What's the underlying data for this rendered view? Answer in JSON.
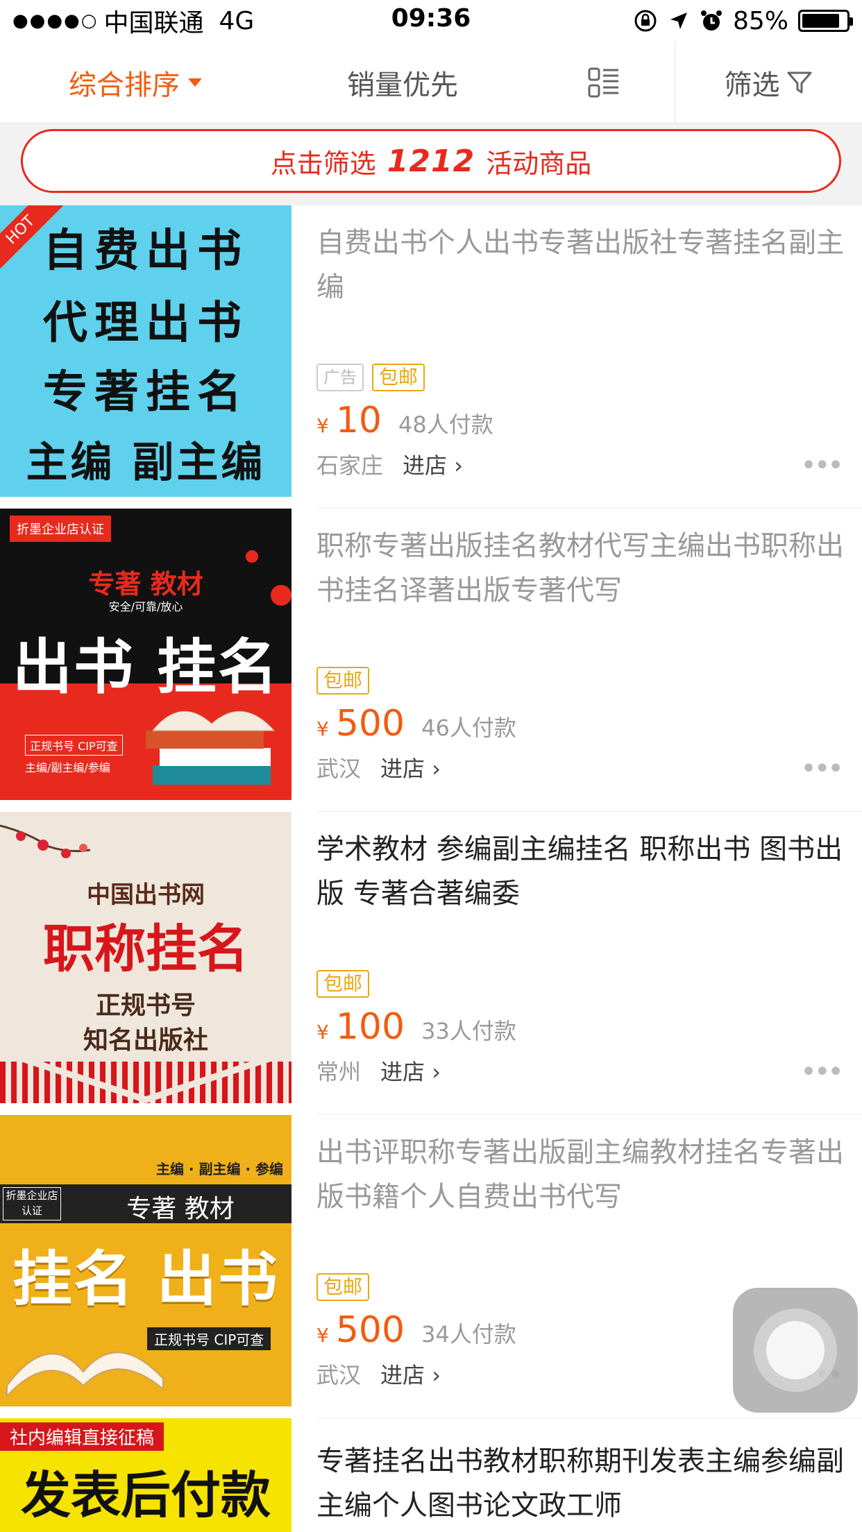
{
  "status_bar": {
    "carrier": "中国联通",
    "network": "4G",
    "time": "09:36",
    "battery": "85%",
    "battery_level": 0.85
  },
  "sort_bar": {
    "comprehensive": "综合排序",
    "sales": "销量优先",
    "filter": "筛选"
  },
  "promo": {
    "prefix": "点击筛选",
    "number": "1212",
    "suffix": "活动商品"
  },
  "colors": {
    "accent": "#f35b0e",
    "promo_red": "#e8291d",
    "tag_gold": "#e9a713"
  },
  "items": [
    {
      "title": "自费出书个人出书专著出版社专著挂名副主编",
      "tags": [
        "广告",
        "包邮"
      ],
      "yen": "¥",
      "price": "10",
      "paid": "48人付款",
      "city": "石家庄",
      "enter": "进店",
      "thumb": {
        "lines": [
          "自费出书",
          "代理出书",
          "专著挂名",
          "主编 副主编"
        ],
        "badge": "HOT"
      }
    },
    {
      "title": "职称专著出版挂名教材代写主编出书职称出书挂名译著出版专著代写",
      "tags": [
        "包邮"
      ],
      "yen": "¥",
      "price": "500",
      "paid": "46人付款",
      "city": "武汉",
      "enter": "进店",
      "thumb": {
        "badge": "折墨企业店认证",
        "sub1": "专著  教材",
        "sub2": "安全/可靠/放心",
        "big": "出书 挂名",
        "note1": "正规书号  CIP可查",
        "note2": "主编/副主编/参编"
      }
    },
    {
      "title": "学术教材 参编副主编挂名 职称出书 图书出版 专著合著编委",
      "tags": [
        "包邮"
      ],
      "yen": "¥",
      "price": "100",
      "paid": "33人付款",
      "city": "常州",
      "enter": "进店",
      "thumb": {
        "top": "中国出书网",
        "big": "职称挂名",
        "l1": "正规书号",
        "l2": "知名出版社"
      }
    },
    {
      "title": "出书评职称专著出版副主编教材挂名专著出版书籍个人自费出书代写",
      "tags": [
        "包邮"
      ],
      "yen": "¥",
      "price": "500",
      "paid": "34人付款",
      "city": "武汉",
      "enter": "进店",
      "thumb": {
        "roles": "主编 · 副主编 · 参编",
        "badge1": "折墨企业店",
        "badge2": "认证",
        "sub": "专著    教材",
        "big": "挂名 出书",
        "note": "正规书号  CIP可查"
      }
    },
    {
      "title": "专著挂名出书教材职称期刊发表主编参编副主编个人图书论文政工师",
      "thumb": {
        "top": "社内编辑直接征稿",
        "big": "发表后付款"
      }
    }
  ]
}
